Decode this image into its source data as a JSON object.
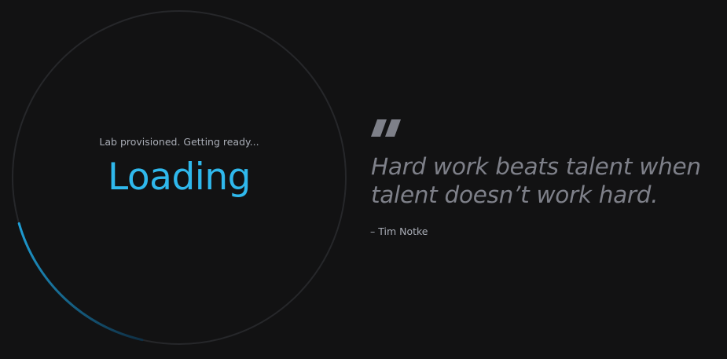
{
  "loader": {
    "status": "Lab provisioned. Getting ready...",
    "title": "Loading",
    "progress_fraction": 0.17,
    "progress_color": "#2fb8ec",
    "track_color": "#26272a"
  },
  "quote": {
    "icon": "quote-icon",
    "text": "Hard work beats talent when talent doesn’t work hard.",
    "author": "– Tim Notke"
  },
  "colors": {
    "background": "#121213",
    "accent": "#2fb8ec",
    "quote_text": "#7e8089",
    "muted_text": "#a9adb6"
  }
}
